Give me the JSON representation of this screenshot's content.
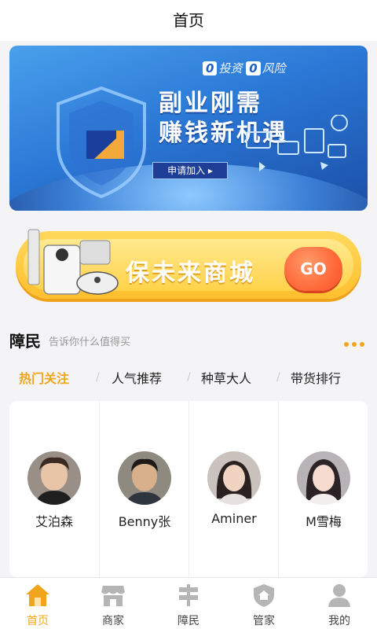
{
  "header": {
    "title": "首页"
  },
  "banner_primary": {
    "tag_zero1": "0",
    "tag_text1": "投资",
    "tag_zero2": "0",
    "tag_text2": "风险",
    "headline_line1": "副业刚需",
    "headline_line2": "赚钱新机遇",
    "join_label": "申请加入 ▸"
  },
  "banner_mall": {
    "title": "保未来商城",
    "go_label": "GO"
  },
  "section": {
    "title": "障民",
    "subtitle": "告诉你什么值得买"
  },
  "tabs": [
    {
      "label": "热门关注",
      "active": true
    },
    {
      "label": "人气推荐",
      "active": false
    },
    {
      "label": "种草大人",
      "active": false
    },
    {
      "label": "带货排行",
      "active": false
    }
  ],
  "tab_separator": "/",
  "people": [
    {
      "name": "艾泊森"
    },
    {
      "name": "Benny张"
    },
    {
      "name": "Aminer"
    },
    {
      "name": "M雪梅"
    }
  ],
  "bottom_nav": [
    {
      "label": "首页",
      "icon": "home-icon",
      "active": true
    },
    {
      "label": "商家",
      "icon": "store-icon",
      "active": false
    },
    {
      "label": "障民",
      "icon": "signpost-icon",
      "active": false
    },
    {
      "label": "管家",
      "icon": "shield-house-icon",
      "active": false
    },
    {
      "label": "我的",
      "icon": "user-icon",
      "active": false
    }
  ],
  "colors": {
    "accent": "#f0a51c",
    "banner_blue": "#2b79d6",
    "mall_yellow": "#ffbf2e",
    "go_orange": "#ff6a3a",
    "nav_inactive": "#b5b5b5"
  }
}
